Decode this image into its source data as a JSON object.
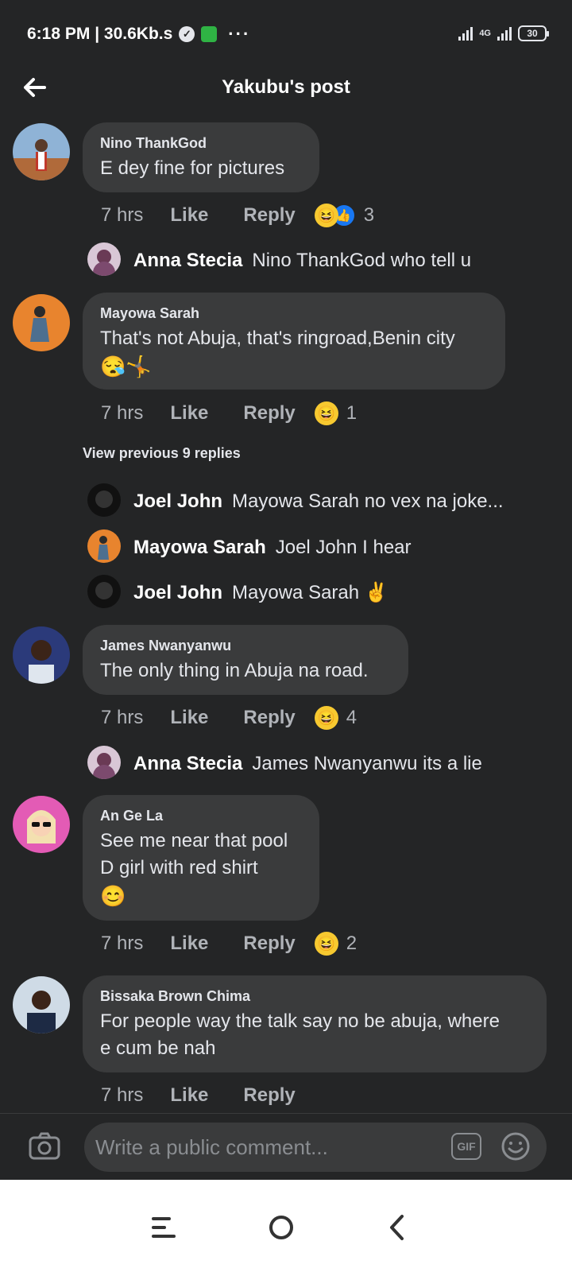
{
  "status_bar": {
    "time_speed": "6:18 PM | 30.6Kb.s",
    "network": "4G",
    "battery": "30"
  },
  "header": {
    "title": "Yakubu's post"
  },
  "comments": [
    {
      "author": "Nino ThankGod",
      "text": "E dey fine for pictures",
      "time": "7 hrs",
      "like": "Like",
      "reply": "Reply",
      "reactions": [
        "haha",
        "like"
      ],
      "reaction_count": "3",
      "avatar_color": "#5b7fa6"
    },
    {
      "author": "Mayowa Sarah",
      "text": "That's not Abuja, that's ringroad,Benin city",
      "emojis": "😪🤸",
      "time": "7 hrs",
      "like": "Like",
      "reply": "Reply",
      "reaction_count": "1",
      "avatar_color": "#e07b2c"
    },
    {
      "author": "James Nwanyanwu",
      "text": "The only thing in Abuja na road.",
      "time": "7 hrs",
      "like": "Like",
      "reply": "Reply",
      "reaction_count": "4",
      "avatar_color": "#2d3e8a"
    },
    {
      "author": "An Ge La",
      "line1": "See me near that pool",
      "line2": "D girl with red shirt",
      "emojis": "😊",
      "time": "7 hrs",
      "like": "Like",
      "reply": "Reply",
      "reaction_count": "2",
      "avatar_color": "#e35bb5"
    },
    {
      "author": "Bissaka Brown Chima",
      "line1": "For people way the talk say no be abuja, where",
      "line2": "e cum be nah",
      "time": "7 hrs",
      "like": "Like",
      "reply": "Reply",
      "avatar_color": "#c9d6e3"
    }
  ],
  "replies": [
    {
      "author": "Anna Stecia",
      "text": "Nino ThankGod who tell u"
    },
    {
      "author": "Joel John",
      "text": "Mayowa Sarah no vex na joke..."
    },
    {
      "author": "Mayowa Sarah",
      "text": "Joel John I hear"
    },
    {
      "author": "Joel John",
      "text": "Mayowa Sarah ✌️"
    },
    {
      "author": "Anna Stecia",
      "text": "James Nwanyanwu its a lie"
    }
  ],
  "view_previous": "View previous 9 replies",
  "composer": {
    "placeholder": "Write a public comment...",
    "gif_label": "GIF"
  },
  "icons": [
    "back-arrow-icon",
    "camera-icon",
    "gif-icon",
    "smiley-icon",
    "menu-icon",
    "home-icon",
    "back-icon"
  ],
  "colors": {
    "background": "#242526",
    "bubble": "#3a3b3c",
    "muted_text": "#b0b3b8",
    "haha_yellow": "#f7c930",
    "like_blue": "#1877f2"
  }
}
